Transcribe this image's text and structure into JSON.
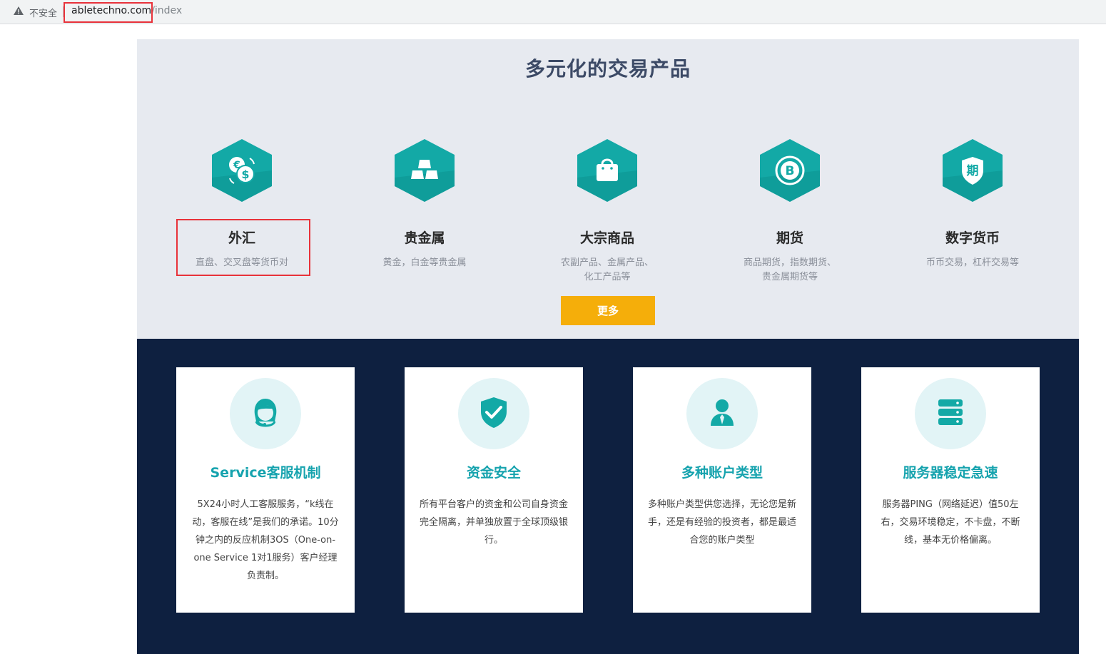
{
  "browser": {
    "security_label": "不安全",
    "url_host": "abletechno.com",
    "url_path": "/index"
  },
  "products": {
    "title": "多元化的交易产品",
    "items": [
      {
        "name": "外汇",
        "desc": "直盘、交叉盘等货币对",
        "icon": "currency-exchange-icon"
      },
      {
        "name": "贵金属",
        "desc": "黄金，白金等贵金属",
        "icon": "gold-bars-icon"
      },
      {
        "name": "大宗商品",
        "desc": "农副产品、金属产品、化工产品等",
        "icon": "shopping-bag-icon"
      },
      {
        "name": "期货",
        "desc": "商品期货，指数期货、贵金属期货等",
        "icon": "bitcoin-icon"
      },
      {
        "name": "数字货币",
        "desc": "币币交易，杠杆交易等",
        "icon": "shield-qi-icon",
        "icon_text": "期"
      }
    ],
    "more_label": "更多"
  },
  "features": [
    {
      "title": "Service客服机制",
      "desc": "5X24小时人工客服服务，“k线在动，客服在线”是我们的承诺。10分钟之内的反应机制3OS（One-on-one Service 1对1服务）客户经理负责制。",
      "icon": "customer-service-icon"
    },
    {
      "title": "资金安全",
      "desc": "所有平台客户的资金和公司自身资金完全隔离，并单独放置于全球顶级银行。",
      "icon": "shield-check-icon"
    },
    {
      "title": "多种账户类型",
      "desc": "多种账户类型供您选择，无论您是新手，还是有经验的投资者，都是最适合您的账户类型",
      "icon": "user-account-icon"
    },
    {
      "title": "服务器稳定急速",
      "desc": "服务器PING（网络延迟）值50左右，交易环境稳定，不卡盘，不断线，基本无价格偏离。",
      "icon": "server-icon"
    }
  ],
  "colors": {
    "teal": "#13a9a6",
    "teal_dark": "#0b8f8c",
    "accent_orange": "#f5ae0a",
    "navy": "#0e2040",
    "annotation_red": "#e8323a"
  }
}
